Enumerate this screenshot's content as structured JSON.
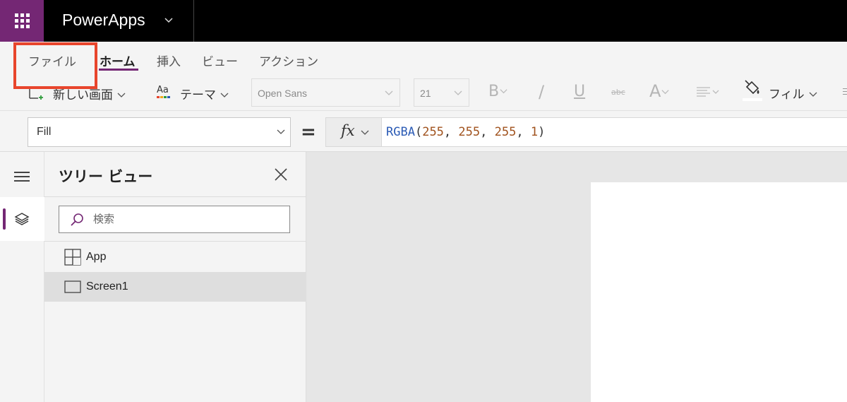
{
  "app": {
    "title": "PowerApps"
  },
  "menu": {
    "tabs": [
      {
        "label": "ファイル"
      },
      {
        "label": "ホーム"
      },
      {
        "label": "挿入"
      },
      {
        "label": "ビュー"
      },
      {
        "label": "アクション"
      }
    ],
    "active_tab": "ホーム"
  },
  "ribbon": {
    "new_screen_label": "新しい画面",
    "theme_label": "テーマ",
    "font_value": "Open Sans",
    "font_size_value": "21",
    "bold_label": "B",
    "italic_label": "/",
    "underline_label": "U",
    "strike_label": "abc",
    "font_color_label": "A",
    "fill_label": "フィル",
    "theme_icon_text": "Aa"
  },
  "formula": {
    "property": "Fill",
    "equals": "=",
    "fx_label": "fx",
    "expression": {
      "fn": "RGBA",
      "open": "(",
      "r": "255",
      "sep1": ", ",
      "g": "255",
      "sep2": ", ",
      "b": "255",
      "sep3": ", ",
      "a": "1",
      "close": ")"
    }
  },
  "tree_view": {
    "title": "ツリー ビュー",
    "search_placeholder": "検索",
    "items": [
      {
        "label": "App",
        "icon": "app-icon"
      },
      {
        "label": "Screen1",
        "icon": "screen-icon",
        "selected": true
      }
    ]
  },
  "colors": {
    "brand": "#742774",
    "highlight": "#e8452c",
    "topbar": "#000000"
  }
}
